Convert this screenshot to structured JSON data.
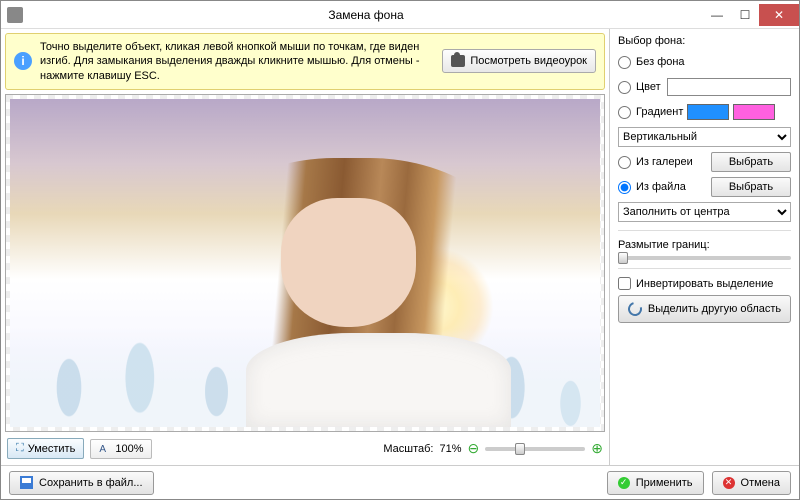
{
  "window": {
    "title": "Замена фона"
  },
  "tip": {
    "text": "Точно выделите объект, кликая левой кнопкой мыши по точкам, где виден изгиб. Для замыкания выделения дважды кликните мышью. Для отмены - нажмите клавишу ESC.",
    "video_btn": "Посмотреть видеоурок"
  },
  "toolbar": {
    "fit": "Уместить",
    "zoom": "100%",
    "scale_label": "Масштаб:",
    "scale_value": "71%"
  },
  "right": {
    "title": "Выбор фона:",
    "none": "Без фона",
    "color": "Цвет",
    "color_value": "#ffffff",
    "gradient": "Градиент",
    "grad_a": "#2090ff",
    "grad_b": "#ff60e0",
    "grad_mode": "Вертикальный",
    "from_gallery": "Из галереи",
    "from_file": "Из файла",
    "select_btn": "Выбрать",
    "fit_mode": "Заполнить от центра",
    "blur_label": "Размытие границ:",
    "invert": "Инвертировать выделение",
    "reselect": "Выделить другую область"
  },
  "footer": {
    "save": "Сохранить в файл...",
    "apply": "Применить",
    "cancel": "Отмена"
  }
}
